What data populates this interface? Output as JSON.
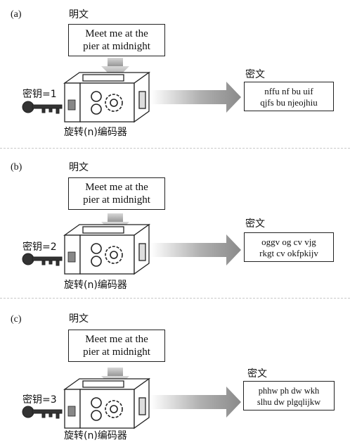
{
  "panels": [
    {
      "label": "(a)",
      "plaintext_title": "明文",
      "plaintext_lines": [
        "Meet me at the",
        "pier at midnight"
      ],
      "key_label": "密钥=1",
      "machine_label": "旋转(n)编码器",
      "ciphertext_title": "密文",
      "ciphertext_lines": [
        "nffu nf bu uif",
        "qjfs bu njeojhiu"
      ]
    },
    {
      "label": "(b)",
      "plaintext_title": "明文",
      "plaintext_lines": [
        "Meet me at the",
        "pier at midnight"
      ],
      "key_label": "密钥=2",
      "machine_label": "旋转(n)编码器",
      "ciphertext_title": "密文",
      "ciphertext_lines": [
        "oggv og cv vjg",
        "rkgt cv okfpkijv"
      ]
    },
    {
      "label": "(c)",
      "plaintext_title": "明文",
      "plaintext_lines": [
        "Meet me at the",
        "pier at midnight"
      ],
      "key_label": "密钥=3",
      "machine_label": "旋转(n)编码器",
      "ciphertext_title": "密文",
      "ciphertext_lines": [
        "phhw ph dw wkh",
        "slhu dw plgqlijkw"
      ]
    }
  ]
}
